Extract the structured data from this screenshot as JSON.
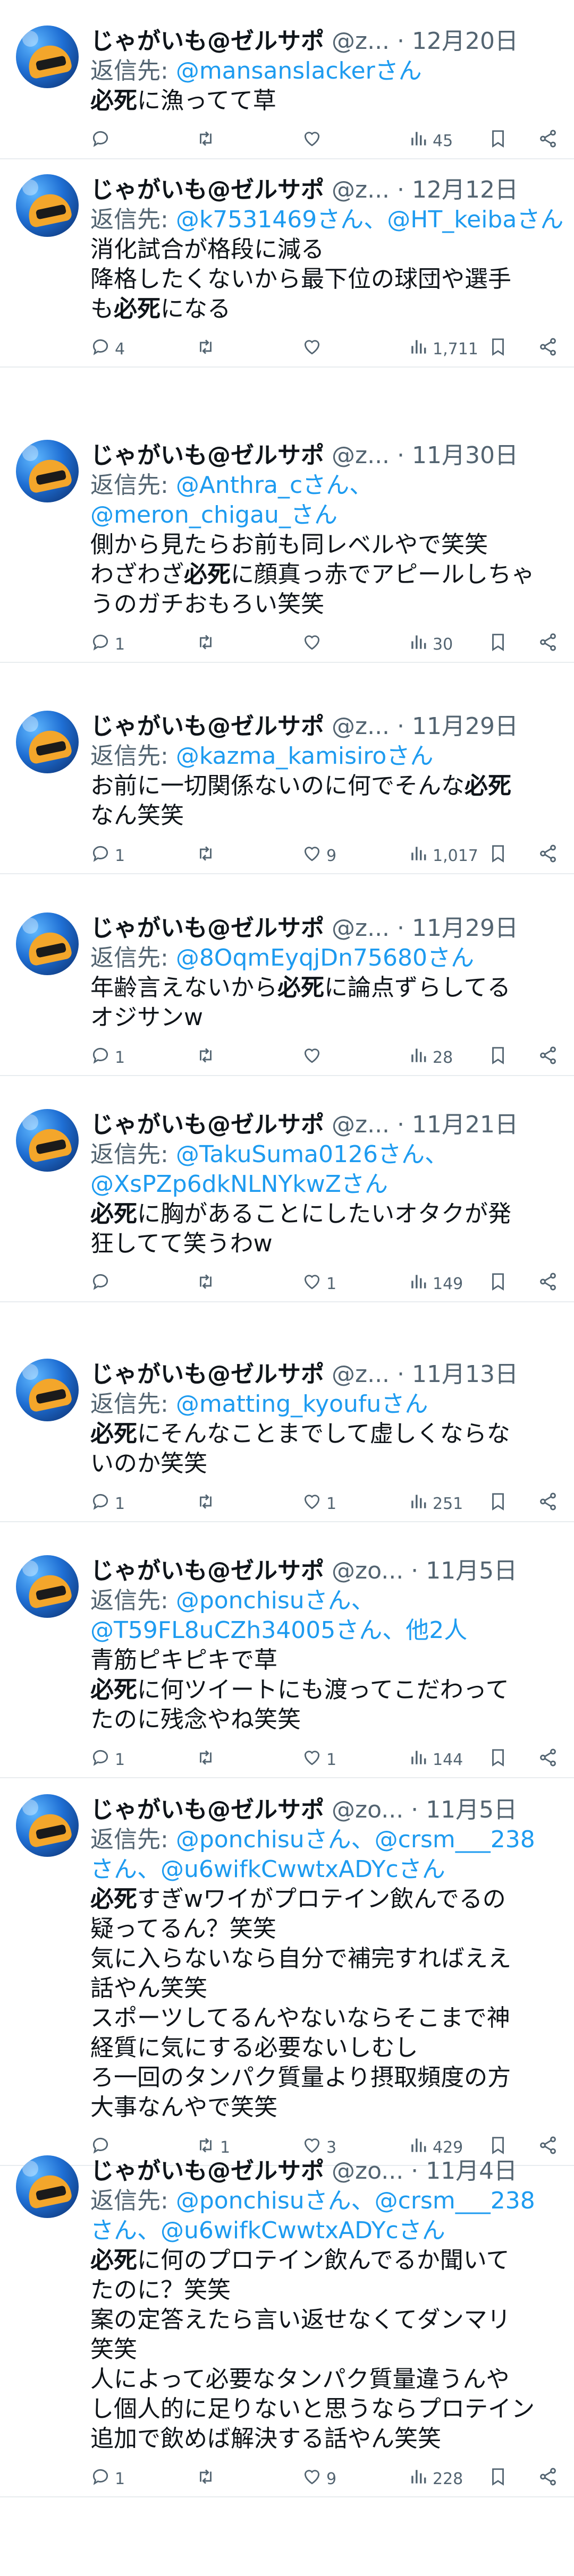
{
  "user": {
    "name": "じゃがいも@ゼルサポ",
    "handle_short": "@z...",
    "handle_short2": "@zo...",
    "dot": "·"
  },
  "reply_prefix": "返信先:",
  "icons": [
    "reply-icon",
    "retweet-icon",
    "like-icon",
    "views-icon",
    "bookmark-icon",
    "share-icon"
  ],
  "tweets": [
    {
      "handle": "@z...",
      "date": "12月20日",
      "reply": [
        "@mansanslackerさん"
      ],
      "text": [
        "必死に漁ってて草"
      ],
      "replies": "",
      "retweets": "",
      "likes": "",
      "views": "45"
    },
    {
      "handle": "@z...",
      "date": "12月12日",
      "reply": [
        "@k7531469さん、@HT_keibaさん"
      ],
      "text": [
        "消化試合が格段に減る",
        "降格したくないから最下位の球団や選手",
        "も必死になる"
      ],
      "replies": "4",
      "retweets": "",
      "likes": "",
      "views": "1,711"
    },
    {
      "handle": "@z...",
      "date": "11月30日",
      "reply": [
        "@Anthra_cさん、",
        "@meron_chigau_さん"
      ],
      "text": [
        "側から見たらお前も同レベルやで笑笑",
        "わざわざ必死に顔真っ赤でアピールしちゃ",
        "うのガチおもろい笑笑"
      ],
      "replies": "1",
      "retweets": "",
      "likes": "",
      "views": "30"
    },
    {
      "handle": "@z...",
      "date": "11月29日",
      "reply": [
        "@kazma_kamisiroさん"
      ],
      "text": [
        "お前に一切関係ないのに何でそんな必死",
        "なん笑笑"
      ],
      "replies": "1",
      "retweets": "",
      "likes": "9",
      "views": "1,017"
    },
    {
      "handle": "@z...",
      "date": "11月29日",
      "reply": [
        "@8OqmEyqjDn75680さん"
      ],
      "text": [
        "年齢言えないから必死に論点ずらしてる",
        "オジサンw"
      ],
      "replies": "1",
      "retweets": "",
      "likes": "",
      "views": "28"
    },
    {
      "handle": "@z...",
      "date": "11月21日",
      "reply": [
        "@TakuSuma0126さん、",
        "@XsPZp6dkNLNYkwZさん"
      ],
      "text": [
        "必死に胸があることにしたいオタクが発",
        "狂してて笑うわw"
      ],
      "replies": "",
      "retweets": "",
      "likes": "1",
      "views": "149"
    },
    {
      "handle": "@z...",
      "date": "11月13日",
      "reply": [
        "@matting_kyoufuさん"
      ],
      "text": [
        "必死にそんなことまでして虚しくならな",
        "いのか笑笑"
      ],
      "replies": "1",
      "retweets": "",
      "likes": "1",
      "views": "251"
    },
    {
      "handle": "@zo...",
      "date": "11月5日",
      "reply": [
        "@ponchisuさん、",
        "@T59FL8uCZh34005さん、他2人"
      ],
      "text": [
        "青筋ピキピキで草",
        "必死に何ツイートにも渡ってこだわって",
        "たのに残念やね笑笑"
      ],
      "replies": "1",
      "retweets": "",
      "likes": "1",
      "views": "144"
    },
    {
      "handle": "@zo...",
      "date": "11月5日",
      "reply": [
        "@ponchisuさん、@crsm___238",
        "さん、@u6wifkCwwtxADYcさん"
      ],
      "text": [
        "必死すぎwワイがプロテイン飲んでるの",
        "疑ってるん？笑笑",
        "気に入らないなら自分で補完すればええ",
        "話やん笑笑",
        "スポーツしてるんやないならそこまで神",
        "経質に気にする必要ないしむし",
        "ろ一回のタンパク質量より摂取頻度の方",
        "大事なんやで笑笑"
      ],
      "replies": "",
      "retweets": "1",
      "likes": "3",
      "views": "429"
    },
    {
      "handle": "@zo...",
      "date": "11月4日",
      "reply": [
        "@ponchisuさん、@crsm___238",
        "さん、@u6wifkCwwtxADYcさん"
      ],
      "text": [
        "必死に何のプロテイン飲んでるか聞いて",
        "たのに？笑笑",
        "案の定答えたら言い返せなくてダンマリ",
        "笑笑",
        "人によって必要なタンパク質量違うんや",
        "し個人的に足りないと思うならプロテイン",
        "追加で飲めば解決する話やん笑笑"
      ],
      "replies": "1",
      "retweets": "",
      "likes": "9",
      "views": "228"
    }
  ]
}
